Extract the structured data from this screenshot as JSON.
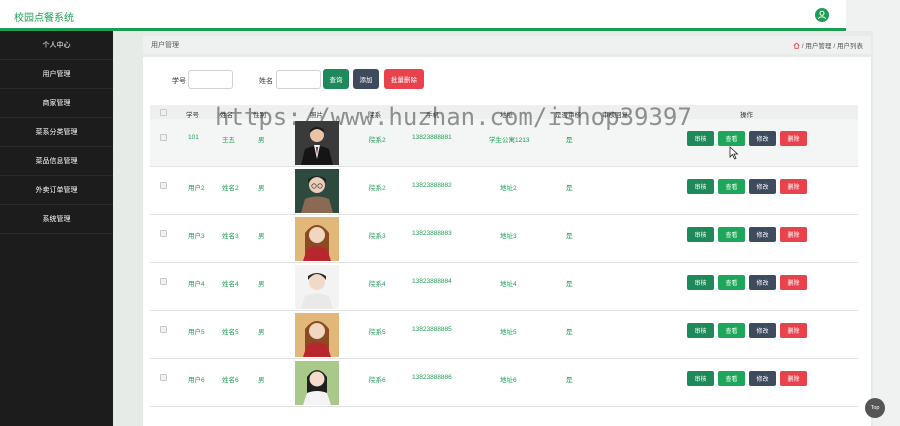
{
  "app": {
    "title": "校园点餐系统"
  },
  "sidebar": {
    "items": [
      {
        "label": "个人中心"
      },
      {
        "label": "用户管理"
      },
      {
        "label": "商家管理"
      },
      {
        "label": "菜系分类管理"
      },
      {
        "label": "菜品信息管理"
      },
      {
        "label": "外卖订单管理"
      },
      {
        "label": "系统管理"
      }
    ]
  },
  "breadcrumb": {
    "title": "用户管理",
    "path": [
      "/ 用户管理",
      "/ 用户列表"
    ]
  },
  "search": {
    "fields": [
      {
        "label": "学号",
        "value": ""
      },
      {
        "label": "姓名",
        "value": ""
      }
    ],
    "buttons": {
      "query": "查询",
      "add": "添加",
      "batch_delete": "批量删除"
    }
  },
  "table": {
    "headers": [
      "学号",
      "姓名",
      "性别",
      "照片",
      "院系",
      "手机",
      "地址",
      "是否审核",
      "审核回复",
      "操作"
    ],
    "rows": [
      {
        "id": "101",
        "name": "王五",
        "gender": "男",
        "dept": "院系2",
        "phone": "13823888881",
        "address": "学生公寓1213",
        "audited": "是",
        "reply": ""
      },
      {
        "id": "用户2",
        "name": "姓名2",
        "gender": "男",
        "dept": "院系2",
        "phone": "13823888882",
        "address": "地址2",
        "audited": "是",
        "reply": ""
      },
      {
        "id": "用户3",
        "name": "姓名3",
        "gender": "男",
        "dept": "院系3",
        "phone": "13823888883",
        "address": "地址3",
        "audited": "是",
        "reply": ""
      },
      {
        "id": "用户4",
        "name": "姓名4",
        "gender": "男",
        "dept": "院系4",
        "phone": "13823888884",
        "address": "地址4",
        "audited": "是",
        "reply": ""
      },
      {
        "id": "用户5",
        "name": "姓名5",
        "gender": "男",
        "dept": "院系5",
        "phone": "13823888885",
        "address": "地址5",
        "audited": "是",
        "reply": ""
      },
      {
        "id": "用户6",
        "name": "姓名6",
        "gender": "男",
        "dept": "院系6",
        "phone": "13823888886",
        "address": "地址6",
        "audited": "是",
        "reply": ""
      }
    ],
    "actions": {
      "audit": "审核",
      "view": "查看",
      "edit": "修改",
      "delete": "删除"
    }
  },
  "watermark": "https://www.huzhan.com/ishop39397",
  "back_to_top": "Top",
  "colors": {
    "accent": "#1e9e55",
    "sidebar": "#1c1c1c",
    "danger": "#e8434d",
    "dark": "#3e4a5e",
    "primary": "#1e8a5b"
  }
}
